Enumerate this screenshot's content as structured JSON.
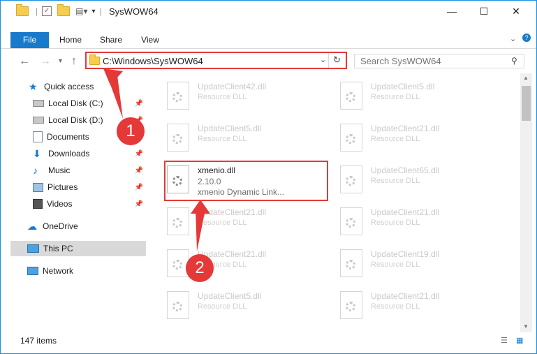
{
  "window": {
    "title": "SysWOW64"
  },
  "window_controls": {
    "minimize": "—",
    "maximize": "☐",
    "close": "✕"
  },
  "ribbon": {
    "tabs": [
      "File",
      "Home",
      "Share",
      "View"
    ]
  },
  "address": {
    "path": "C:\\Windows\\SysWOW64"
  },
  "search": {
    "placeholder": "Search SysWOW64"
  },
  "sidebar": {
    "quick_access": "Quick access",
    "items": [
      {
        "label": "Local Disk (C:)",
        "pinned": true
      },
      {
        "label": "Local Disk (D:)",
        "pinned": true
      },
      {
        "label": "Documents",
        "pinned": true
      },
      {
        "label": "Downloads",
        "pinned": true
      },
      {
        "label": "Music",
        "pinned": true
      },
      {
        "label": "Pictures",
        "pinned": true
      },
      {
        "label": "Videos",
        "pinned": true
      }
    ],
    "onedrive": "OneDrive",
    "this_pc": "This PC",
    "network": "Network"
  },
  "files": {
    "left": [
      {
        "name": "UpdateClient42.dll",
        "type": "Resource DLL"
      },
      {
        "name": "UpdateClient5.dll",
        "type": "Resource DLL"
      },
      {
        "name": "xmenio.dll",
        "version": "2.10.0",
        "desc": "xmenio Dynamic Link..."
      },
      {
        "name": "UpdateClient21.dll",
        "type": "Resource DLL"
      },
      {
        "name": "UpdateClient21.dll",
        "type": "Resource DLL"
      },
      {
        "name": "UpdateClient5.dll",
        "type": "Resource DLL"
      }
    ],
    "right": [
      {
        "name": "UpdateClient5.dll",
        "type": "Resource DLL"
      },
      {
        "name": "UpdateClient21.dll",
        "type": "Resource DLL"
      },
      {
        "name": "UpdateClient65.dll",
        "type": "Resource DLL"
      },
      {
        "name": "UpdateClient21.dll",
        "type": "Resource DLL"
      },
      {
        "name": "UpdateClient19.dll",
        "type": "Resource DLL"
      },
      {
        "name": "UpdateClient21.dll",
        "type": "Resource DLL"
      }
    ]
  },
  "status": {
    "items": "147 items"
  },
  "annotations": {
    "step1": "1",
    "step2": "2"
  },
  "colors": {
    "accent": "#1979ca",
    "highlight": "#e23a3a"
  }
}
